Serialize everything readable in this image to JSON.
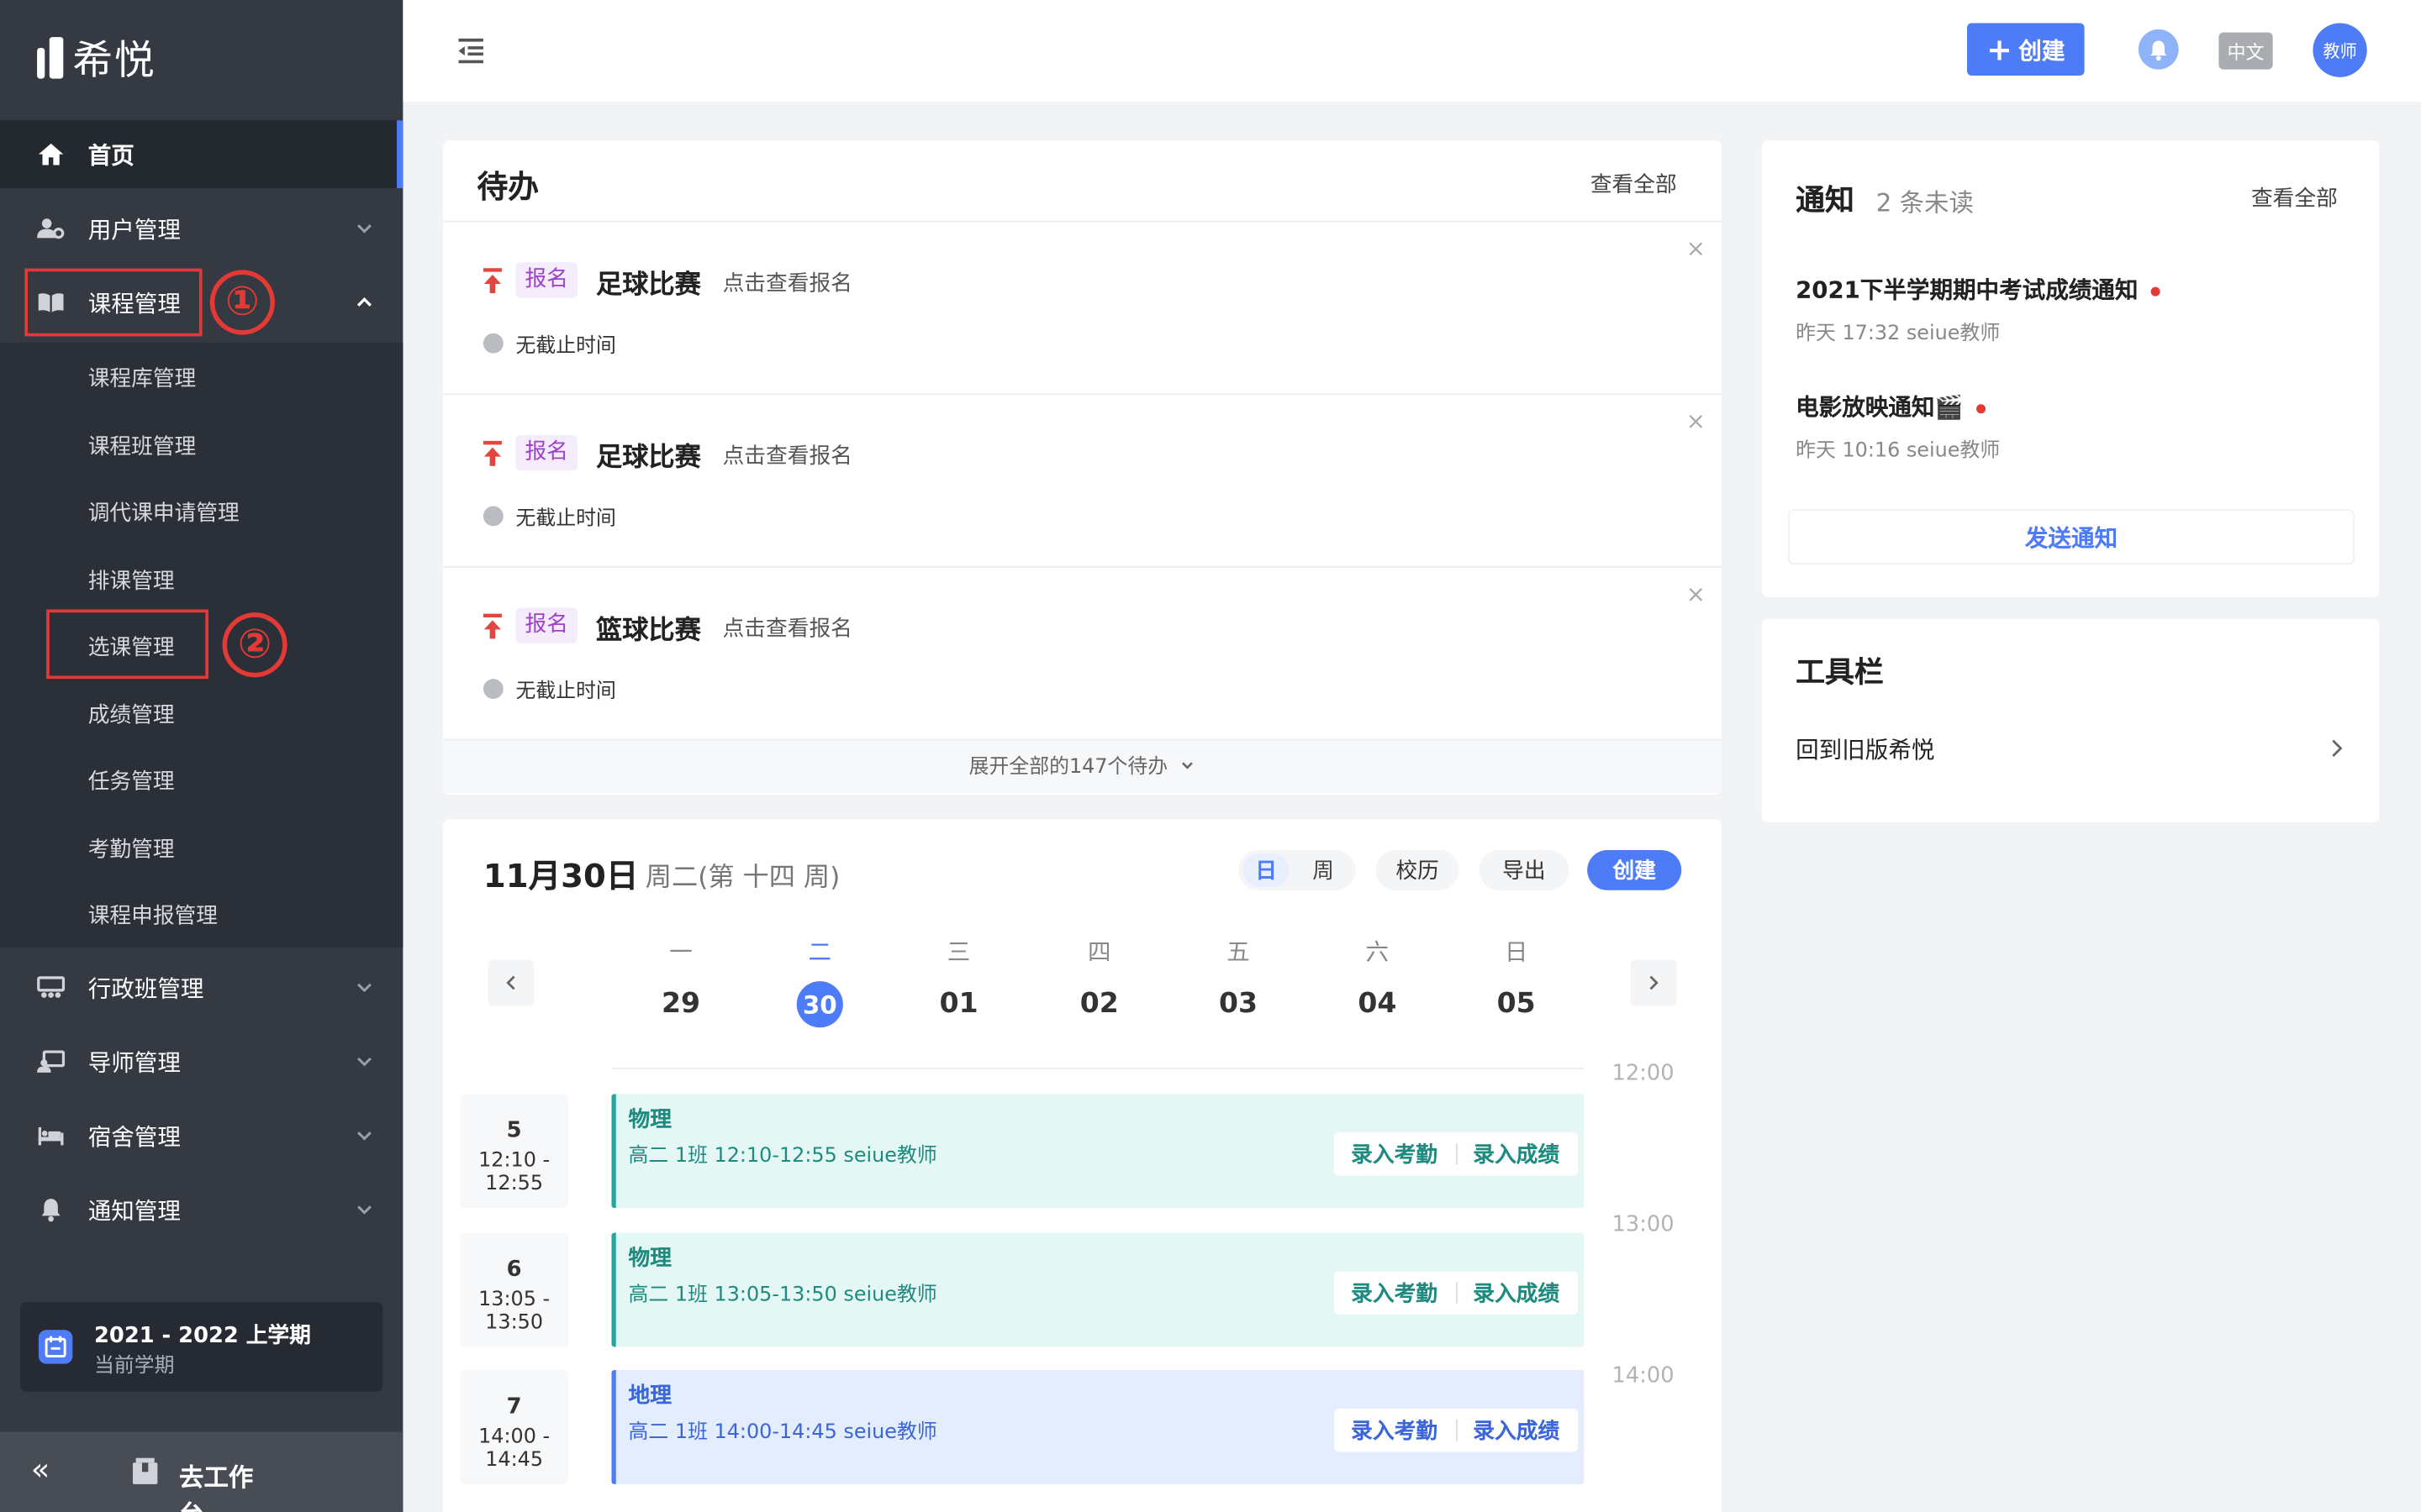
{
  "brand": {
    "name": "希悦"
  },
  "sidebar": {
    "home": "首页",
    "user_mgmt": "用户管理",
    "course_mgmt": "课程管理",
    "course_sub": [
      "课程库管理",
      "课程班管理",
      "调代课申请管理",
      "排课管理",
      "选课管理",
      "成绩管理",
      "任务管理",
      "考勤管理",
      "课程申报管理"
    ],
    "class_mgmt": "行政班管理",
    "mentor_mgmt": "导师管理",
    "dorm_mgmt": "宿舍管理",
    "notice_mgmt": "通知管理",
    "annotation_1": "①",
    "annotation_2": "②",
    "term_title": "2021 - 2022 上学期",
    "term_sub": "当前学期",
    "collapse": "«",
    "workbench": "去工作台"
  },
  "topbar": {
    "create_label": "创建",
    "lang": "中文",
    "avatar": "教师"
  },
  "todo": {
    "title": "待办",
    "view_all": "查看全部",
    "items": [
      {
        "tag": "报名",
        "title": "足球比赛",
        "hint": "点击查看报名",
        "deadline": "无截止时间"
      },
      {
        "tag": "报名",
        "title": "足球比赛",
        "hint": "点击查看报名",
        "deadline": "无截止时间"
      },
      {
        "tag": "报名",
        "title": "篮球比赛",
        "hint": "点击查看报名",
        "deadline": "无截止时间"
      }
    ],
    "close": "×",
    "expand": "展开全部的147个待办"
  },
  "calendar": {
    "date": "11月30日",
    "weekday": "周二(第 十四 周)",
    "view_day": "日",
    "view_week": "周",
    "school_calendar": "校历",
    "export": "导出",
    "create": "创建",
    "days": [
      {
        "name": "一",
        "num": "29"
      },
      {
        "name": "二",
        "num": "30"
      },
      {
        "name": "三",
        "num": "01"
      },
      {
        "name": "四",
        "num": "02"
      },
      {
        "name": "五",
        "num": "03"
      },
      {
        "name": "六",
        "num": "04"
      },
      {
        "name": "日",
        "num": "05"
      }
    ],
    "hours": [
      "12:00",
      "13:00",
      "14:00"
    ],
    "lessons": [
      {
        "period": "5",
        "time": "12:10 - 12:55",
        "subject": "物理",
        "detail": "高二  1班  12:10-12:55  seiue教师",
        "attendance": "录入考勤",
        "grade": "录入成绩"
      },
      {
        "period": "6",
        "time": "13:05 - 13:50",
        "subject": "物理",
        "detail": "高二  1班  13:05-13:50  seiue教师",
        "attendance": "录入考勤",
        "grade": "录入成绩"
      },
      {
        "period": "7",
        "time": "14:00 - 14:45",
        "subject": "地理",
        "detail": "高二  1班  14:00-14:45  seiue教师",
        "attendance": "录入考勤",
        "grade": "录入成绩"
      }
    ]
  },
  "notices": {
    "title": "通知",
    "unread": "2 条未读",
    "view_all": "查看全部",
    "items": [
      {
        "title": "2021下半学期期中考试成绩通知",
        "meta": "昨天 17:32  seiue教师"
      },
      {
        "title": "电影放映通知🎬",
        "meta": "昨天 10:16  seiue教师"
      }
    ],
    "send": "发送通知"
  },
  "toolbar": {
    "title": "工具栏",
    "item": "回到旧版希悦"
  },
  "colors": {
    "accent": "#4e7cf6",
    "sidebar_bg": "#343942",
    "annotation_red": "#e53935",
    "lesson_teal_bg": "#e4f7f4",
    "lesson_teal": "#26a69a",
    "lesson_blue_bg": "#e3edfd"
  }
}
